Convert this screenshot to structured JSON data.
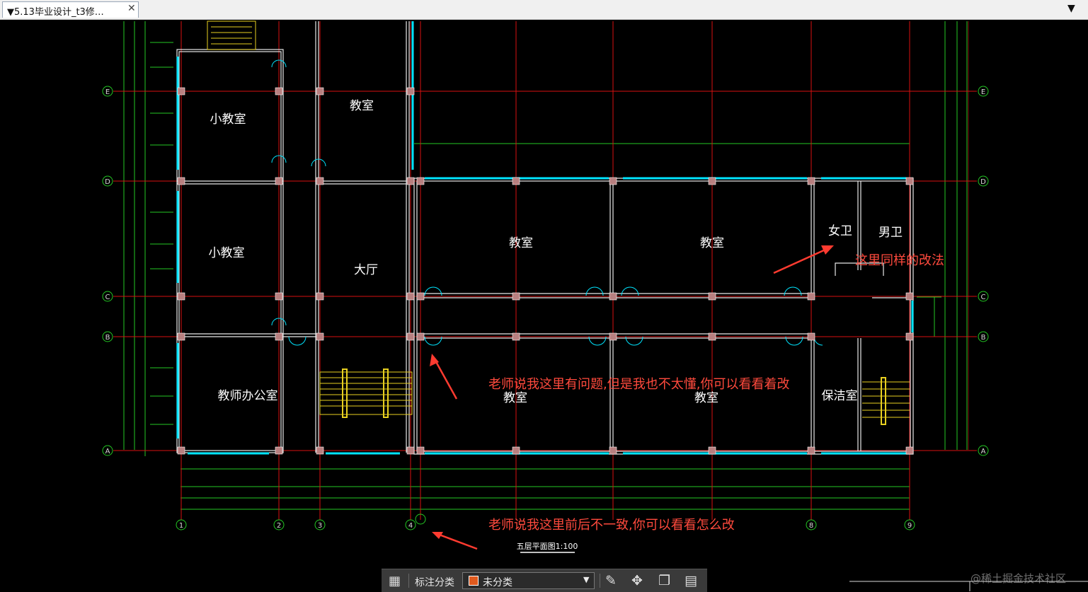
{
  "tab": {
    "title": "▼5.13毕业设计_t3修…",
    "close": "✕"
  },
  "window": {
    "dropdown_arrow": "▼"
  },
  "drawing": {
    "rooms": [
      {
        "id": "small-classroom-1",
        "label": "小教室"
      },
      {
        "id": "classroom-top",
        "label": "教室"
      },
      {
        "id": "small-classroom-2",
        "label": "小教室"
      },
      {
        "id": "hall",
        "label": "大厅"
      },
      {
        "id": "classroom-mid-left",
        "label": "教室"
      },
      {
        "id": "classroom-mid-right",
        "label": "教室"
      },
      {
        "id": "womens-restroom",
        "label": "女卫"
      },
      {
        "id": "mens-restroom",
        "label": "男卫"
      },
      {
        "id": "teacher-office",
        "label": "教师办公室"
      },
      {
        "id": "classroom-bottom-left",
        "label": "教室"
      },
      {
        "id": "classroom-bottom-right",
        "label": "教室"
      },
      {
        "id": "janitor-room",
        "label": "保洁室"
      }
    ],
    "axis_rows": [
      "E",
      "D",
      "C",
      "B",
      "A"
    ],
    "axis_cols": [
      "1",
      "2",
      "3",
      "4",
      "8",
      "9"
    ],
    "plan_title": "五层平面图1:100",
    "annotations": [
      "这里同样的改法",
      "老师说我这里有问题,但是我也不太懂,你可以看看着改",
      "老师说我这里前后不一致,你可以看看怎么改"
    ],
    "colors": {
      "grid": "#e01010",
      "wall": "#ffffff",
      "window": "#00e5ff",
      "dim": "#23c823",
      "annotation": "#ff3b30"
    }
  },
  "toolbar": {
    "grid_icon": "grid-icon",
    "label": "标注分类",
    "select_value": "未分类",
    "icons": [
      "edit-icon",
      "move-icon",
      "copy-icon",
      "paste-icon"
    ]
  },
  "watermark": "@稀土掘金技术社区"
}
